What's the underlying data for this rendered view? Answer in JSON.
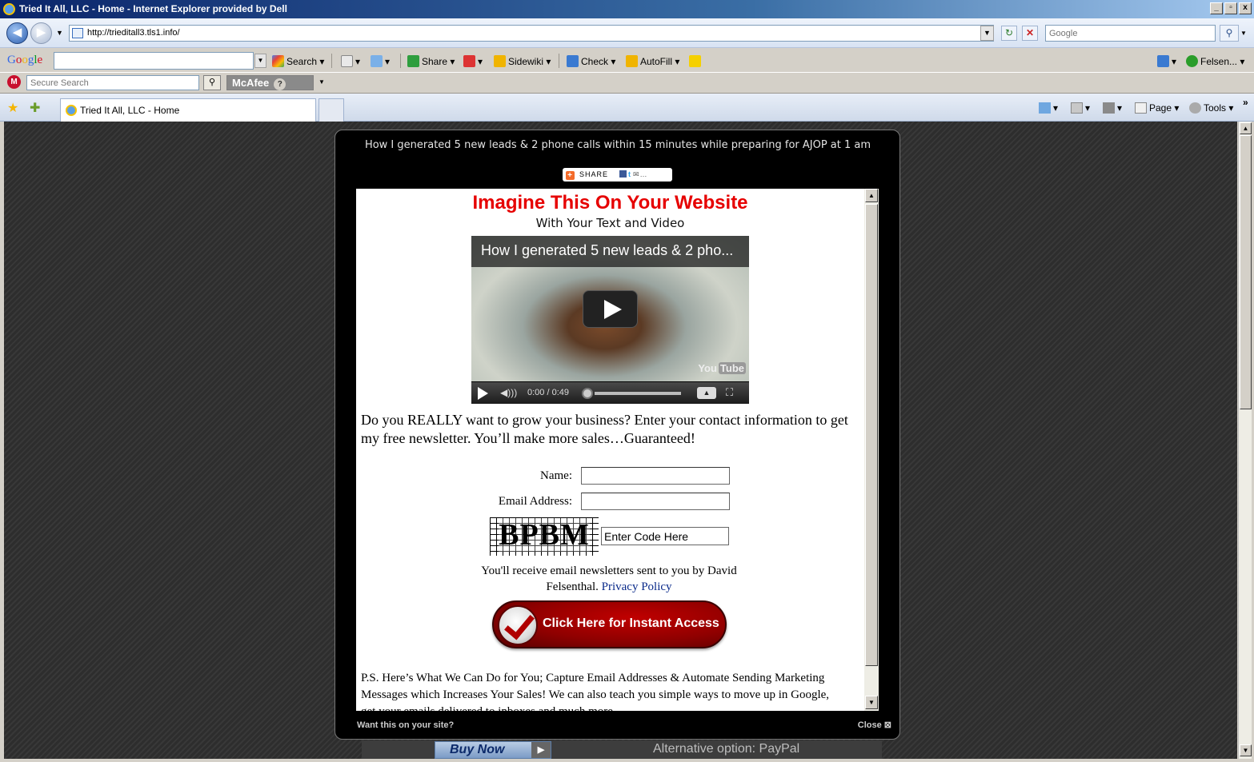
{
  "window": {
    "title": "Tried It All, LLC - Home - Internet Explorer provided by Dell",
    "minimize": "_",
    "maximize": " ",
    "close": "x"
  },
  "address_bar": {
    "url": "http://trieditall3.tls1.info/",
    "search_placeholder": "Google"
  },
  "google_toolbar": {
    "logo": "Google",
    "search_label": "Search",
    "share_label": "Share",
    "sidewiki_label": "Sidewiki",
    "check_label": "Check",
    "autofill_label": "AutoFill",
    "user_label": "Felsen..."
  },
  "mcafee_toolbar": {
    "search_placeholder": "Secure Search",
    "brand": "McAfee",
    "help": "?"
  },
  "tab_bar": {
    "tab_title": "Tried It All, LLC - Home",
    "page_menu": "Page",
    "tools_menu": "Tools",
    "more": "»"
  },
  "lightbox": {
    "title": "How I generated 5 new leads & 2 phone calls within 15 minutes while preparing for AJOP at 1 am",
    "share_label": "SHARE",
    "footer_left": "Want this on your site?",
    "footer_right": "Close ⊠",
    "headline": "Imagine This On Your Website",
    "subheadline": "With Your Text and Video",
    "video": {
      "title": "How I generated 5 new leads & 2 pho...",
      "time": "0:00 / 0:49",
      "brand": "You",
      "brand_tube": "Tube"
    },
    "pitch": "Do you REALLY want to grow your business? Enter your contact information to get my free newsletter. You’ll make more sales…Guaranteed!",
    "form": {
      "name_label": "Name:",
      "email_label": "Email Address:",
      "captcha_text": "BPBM",
      "code_placeholder": "Enter Code Here",
      "notice_text": "You'll receive email newsletters sent to you by David Felsenthal.",
      "privacy_link": "Privacy Policy"
    },
    "cta_label": "Click Here for Instant Access",
    "ps_text": "P.S. Here’s What We Can Do for You; Capture Email Addresses & Automate Sending Marketing Messages which Increases Your Sales!  We can also teach you simple ways to move up in Google, get your emails delivered to inboxes and much more."
  },
  "page_behind": {
    "buy_now": "Buy Now",
    "alternative": "Alternative option: PayPal"
  }
}
